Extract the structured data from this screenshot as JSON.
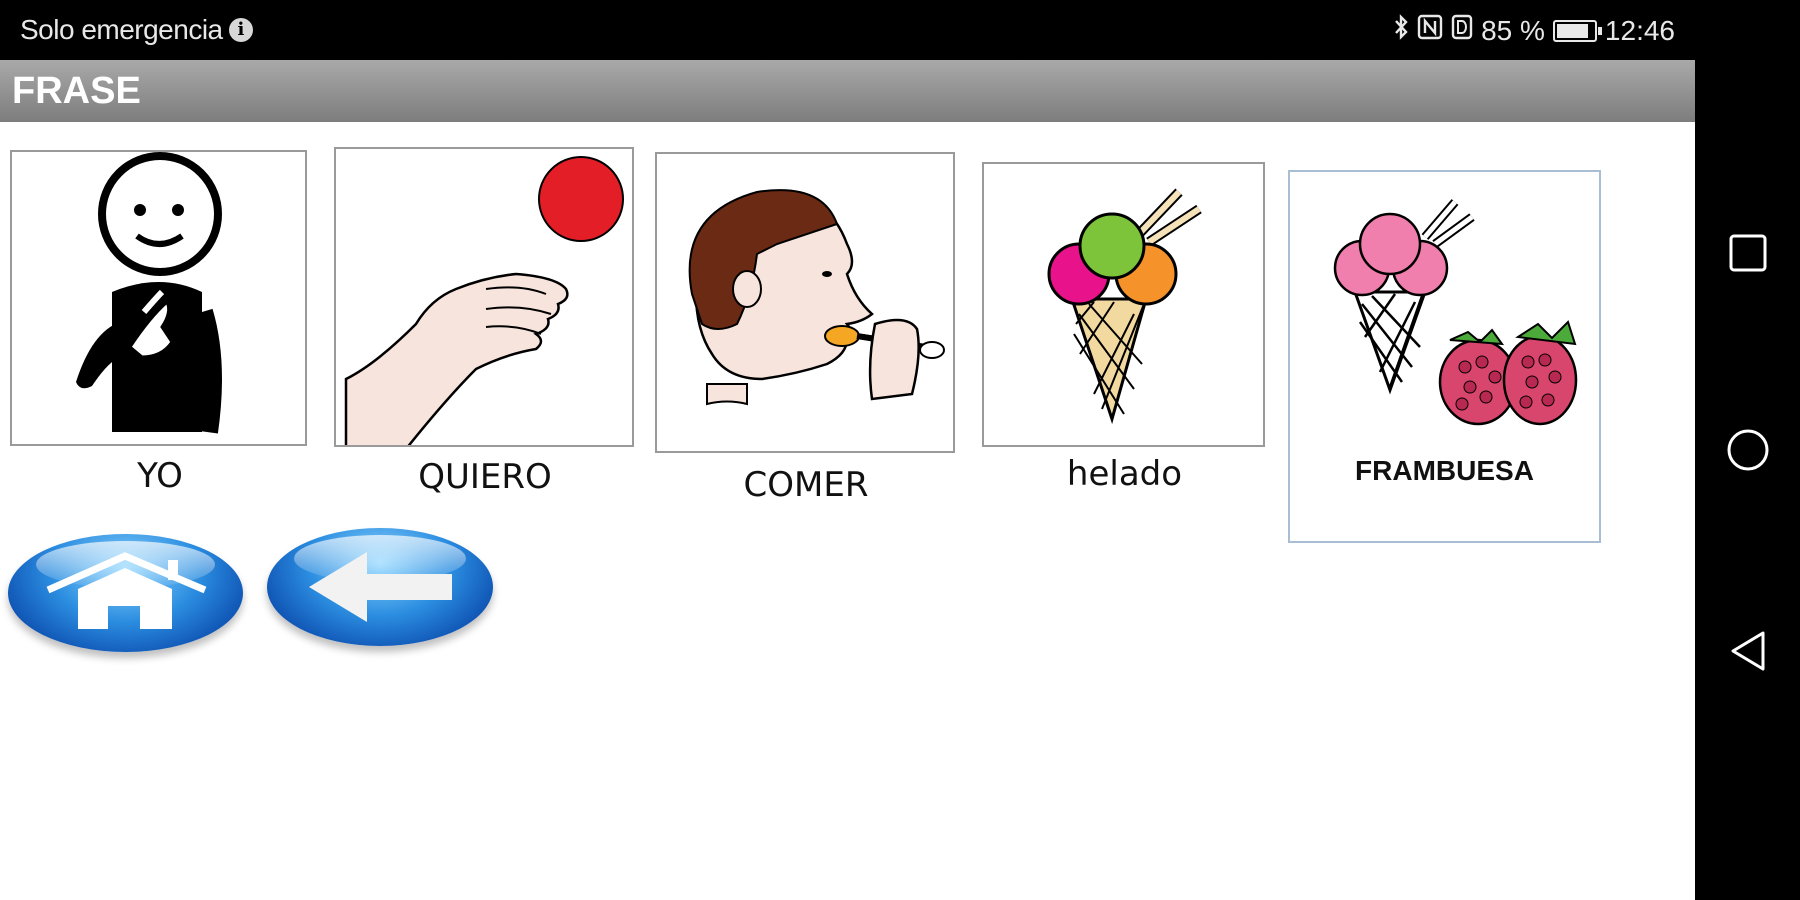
{
  "status_bar": {
    "carrier_text": "Solo emergencia",
    "info_icon": "info-icon",
    "battery_text": "85 %",
    "battery_level": 0.85,
    "time": "12:46",
    "icons": [
      "bluetooth-icon",
      "nfc-icon",
      "data-icon",
      "battery-icon"
    ]
  },
  "header": {
    "title": "FRASE"
  },
  "sentence": [
    {
      "label": "YO",
      "icon": "person-pointing-self-icon"
    },
    {
      "label": "QUIERO",
      "icon": "hand-reaching-ball-icon"
    },
    {
      "label": "COMER",
      "icon": "person-eating-icon"
    },
    {
      "label": "helado",
      "icon": "ice-cream-cone-icon"
    },
    {
      "label": "FRAMBUESA",
      "icon": "raspberry-ice-cream-icon"
    }
  ],
  "nav_buttons": [
    {
      "name": "home",
      "icon": "home-icon"
    },
    {
      "name": "back",
      "icon": "arrow-left-icon"
    }
  ],
  "system_nav": [
    "recent-apps-icon",
    "home-circle-icon",
    "back-triangle-icon"
  ],
  "colors": {
    "title_bar": "#8a8a8a",
    "button_blue": "#2b8de0",
    "ball_red": "#e41e26"
  }
}
